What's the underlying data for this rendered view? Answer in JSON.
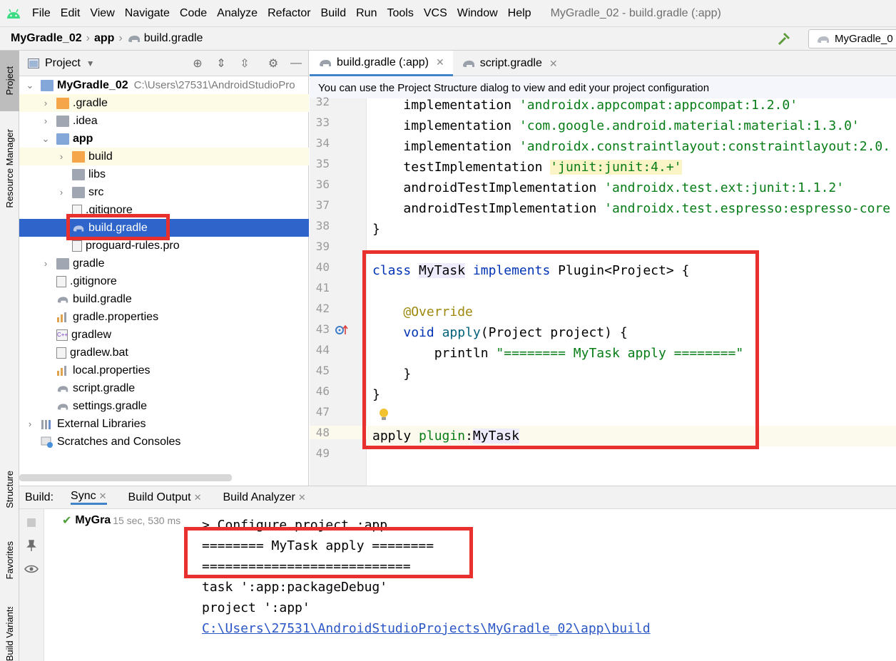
{
  "menubar": {
    "items": [
      "File",
      "Edit",
      "View",
      "Navigate",
      "Code",
      "Analyze",
      "Refactor",
      "Build",
      "Run",
      "Tools",
      "VCS",
      "Window",
      "Help"
    ],
    "window_title": "MyGradle_02 - build.gradle (:app)"
  },
  "breadcrumb": {
    "project": "MyGradle_02",
    "module": "app",
    "file": "build.gradle"
  },
  "run_config": "MyGradle_0",
  "left_strip": {
    "project": "Project",
    "resource_manager": "Resource Manager",
    "structure": "Structure",
    "favorites": "Favorites",
    "build_variants": "Build Variants"
  },
  "project_panel": {
    "title": "Project",
    "root_name": "MyGradle_02",
    "root_path": "C:\\Users\\27531\\AndroidStudioPro",
    "items": [
      ".gradle",
      ".idea",
      "app",
      "build",
      "libs",
      "src",
      ".gitignore",
      "build.gradle",
      "proguard-rules.pro",
      "gradle",
      ".gitignore",
      "build.gradle",
      "gradle.properties",
      "gradlew",
      "gradlew.bat",
      "local.properties",
      "script.gradle",
      "settings.gradle",
      "External Libraries",
      "Scratches and Consoles"
    ]
  },
  "editor": {
    "tabs": [
      "build.gradle (:app)",
      "script.gradle"
    ],
    "banner": "You can use the Project Structure dialog to view and edit your project configuration",
    "line_numbers": [
      "32",
      "33",
      "34",
      "35",
      "36",
      "37",
      "38",
      "39",
      "40",
      "41",
      "42",
      "43",
      "44",
      "45",
      "46",
      "47",
      "48",
      "49"
    ],
    "code": {
      "l32_kw": "implementation",
      "l32_str": "'androidx.appcompat:appcompat:1.2.0'",
      "l33_kw": "implementation",
      "l33_str": "'com.google.android.material:material:1.3.0'",
      "l34_kw": "implementation",
      "l34_str": "'androidx.constraintlayout:constraintlayout:2.0.",
      "l35_kw": "testImplementation",
      "l35_str": "'junit:junit:4.+'",
      "l36_kw": "androidTestImplementation",
      "l36_str": "'androidx.test.ext:junit:1.1.2'",
      "l37_kw": "androidTestImplementation",
      "l37_str": "'androidx.test.espresso:espresso-core",
      "l38": "}",
      "l40_class": "class",
      "l40_name": "MyTask",
      "l40_impl": "implements",
      "l40_rest": "Plugin<Project> {",
      "l42": "@Override",
      "l43_void": "void",
      "l43_fn": "apply",
      "l43_rest": "(Project project) {",
      "l44_fn": "println",
      "l44_str": "\"======== MyTask apply ========\"",
      "l45": "}",
      "l46": "}",
      "l48_a": "apply",
      "l48_b": "plugin",
      "l48_c": ":",
      "l48_d": "MyTask"
    }
  },
  "build_panel": {
    "label": "Build:",
    "tabs": [
      "Sync",
      "Build Output",
      "Build Analyzer"
    ],
    "tree_item": "MyGra",
    "tree_time": "15 sec, 530 ms",
    "output": [
      "> Configure project :app",
      "======== MyTask apply ========",
      "===========================",
      "task ':app:packageDebug'",
      "project ':app'",
      "C:\\Users\\27531\\AndroidStudioProjects\\MyGradle_02\\app\\build"
    ]
  },
  "colors": {
    "highlight_box": "#e8302e",
    "selection": "#2f65ca",
    "keyword": "#0033b3",
    "string": "#067d17",
    "annotation": "#9e880d"
  }
}
